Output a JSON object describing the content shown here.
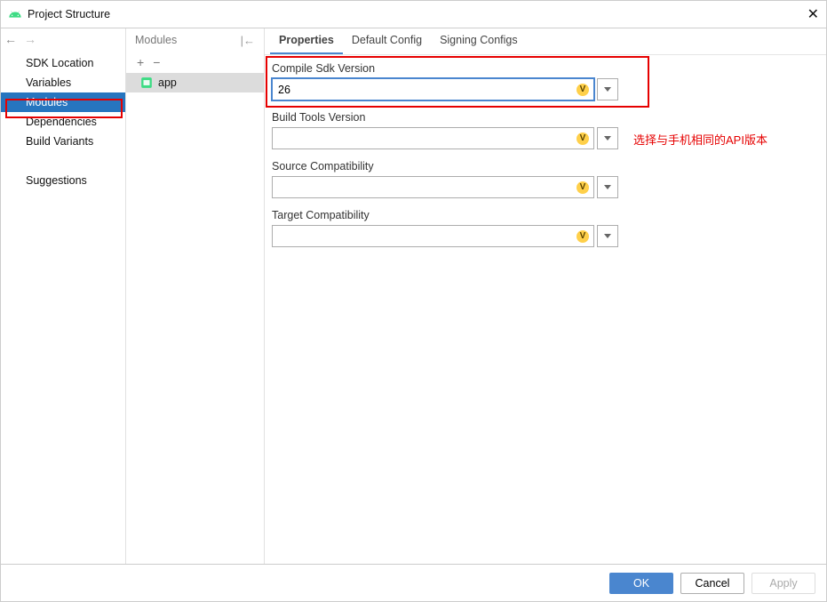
{
  "window": {
    "title": "Project Structure"
  },
  "sidebar": {
    "items": [
      {
        "label": "SDK Location"
      },
      {
        "label": "Variables"
      },
      {
        "label": "Modules",
        "selected": true
      },
      {
        "label": "Dependencies"
      },
      {
        "label": "Build Variants"
      },
      {
        "label": "Suggestions"
      }
    ]
  },
  "modules": {
    "header_label": "Modules",
    "items": [
      {
        "name": "app"
      }
    ]
  },
  "tabs": [
    {
      "label": "Properties",
      "active": true
    },
    {
      "label": "Default Config"
    },
    {
      "label": "Signing Configs"
    }
  ],
  "form": {
    "compile_sdk": {
      "label": "Compile Sdk Version",
      "value": "26",
      "badge": "V"
    },
    "build_tools": {
      "label": "Build Tools Version",
      "value": "",
      "badge": "V"
    },
    "source_compat": {
      "label": "Source Compatibility",
      "value": "",
      "badge": "V"
    },
    "target_compat": {
      "label": "Target Compatibility",
      "value": "",
      "badge": "V"
    }
  },
  "annotation": {
    "note": "选择与手机相同的API版本"
  },
  "footer": {
    "ok": "OK",
    "cancel": "Cancel",
    "apply": "Apply"
  }
}
